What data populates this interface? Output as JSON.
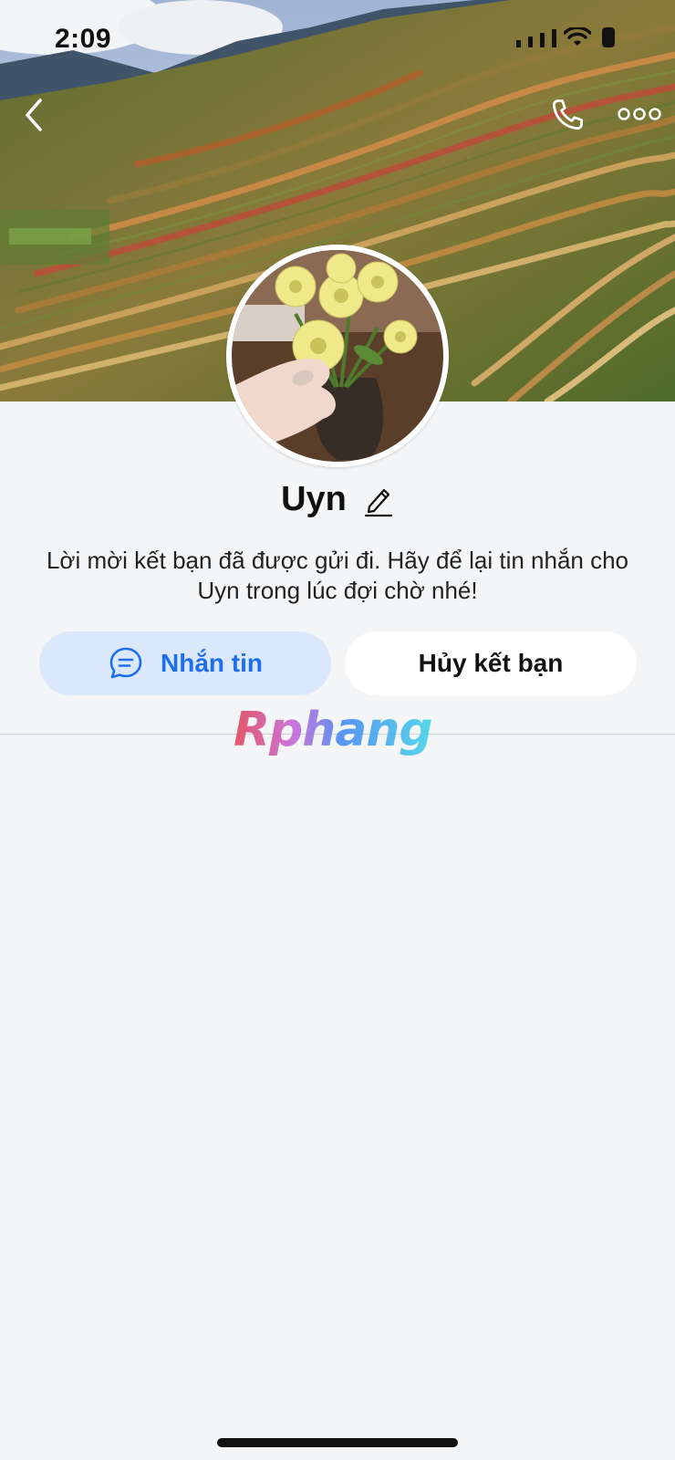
{
  "status_bar": {
    "time": "2:09"
  },
  "nav": {
    "back_icon": "chevron-left-icon",
    "call_icon": "phone-icon",
    "more_icon": "more-horizontal-icon"
  },
  "profile": {
    "name": "Uyn",
    "edit_icon": "pencil-icon",
    "request_message": "Lời mời kết bạn đã được gửi đi. Hãy để lại tin nhắn cho Uyn trong lúc đợi chờ nhé!"
  },
  "actions": {
    "message_label": "Nhắn tin",
    "message_icon": "chat-bubble-icon",
    "cancel_label": "Hủy kết bạn"
  },
  "watermark": {
    "text": "Rphang"
  },
  "colors": {
    "accent": "#1e6ef0",
    "accent_bg": "#dbe8fc",
    "page_bg": "#f4f5f7"
  }
}
